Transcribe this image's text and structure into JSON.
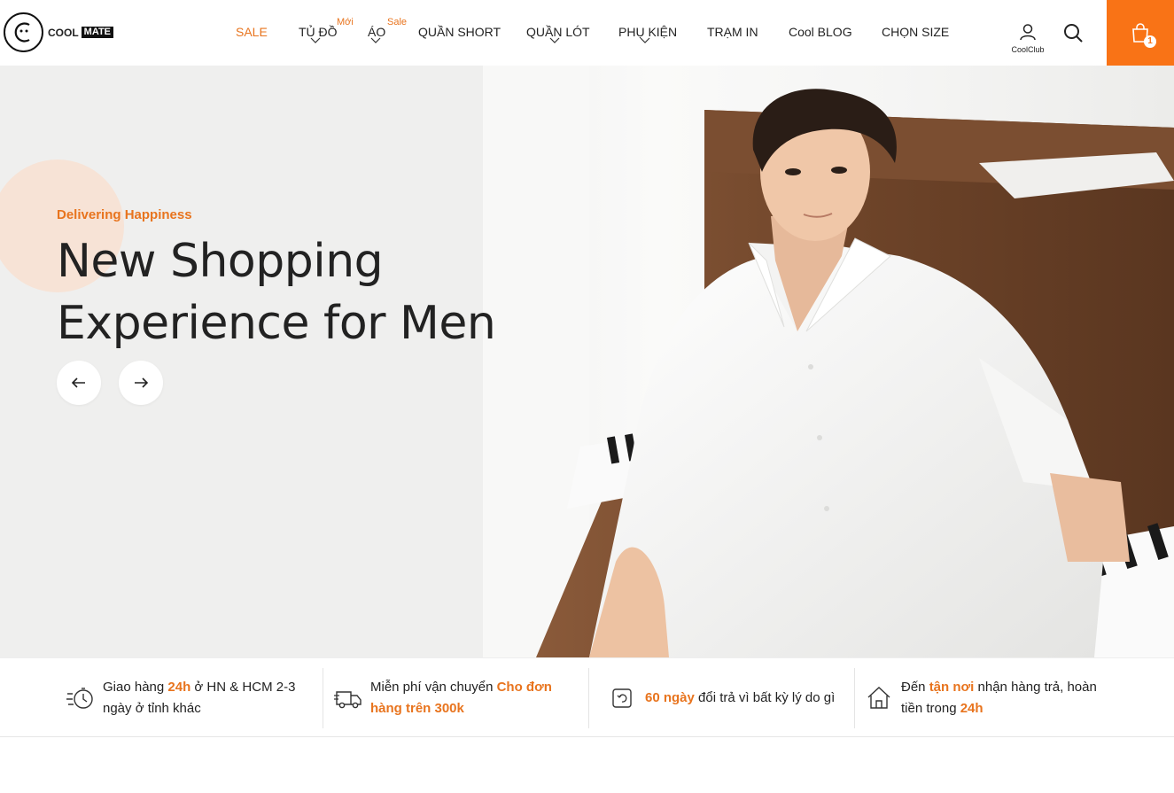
{
  "brand": {
    "logo_word1": "COOL",
    "logo_word2": "MATE",
    "accent": "#f97316"
  },
  "nav": {
    "items": [
      {
        "label": "SALE"
      },
      {
        "label": "TỦ ĐỒ",
        "badge": "Mới"
      },
      {
        "label": "ÁO",
        "badge": "Sale"
      },
      {
        "label": "QUẦN SHORT"
      },
      {
        "label": "QUẦN LÓT"
      },
      {
        "label": "PHỤ KIỆN"
      },
      {
        "label": "TRẠM IN"
      },
      {
        "label": "Cool BLOG"
      },
      {
        "label": "CHỌN SIZE"
      }
    ]
  },
  "header_actions": {
    "account_label": "CoolClub",
    "cart_count": "1"
  },
  "hero": {
    "eyebrow": "Delivering Happiness",
    "headline_line1": "New Shopping",
    "headline_line2": "Experience for Men",
    "prev_icon": "arrow-left-icon",
    "next_icon": "arrow-right-icon"
  },
  "features": [
    {
      "icon": "fast-delivery-icon",
      "t1": "Giao hàng ",
      "h1": "24h",
      "t2": " ở HN & HCM 2-3 ngày ở tỉnh khác",
      "h2": "",
      "t3": ""
    },
    {
      "icon": "truck-icon",
      "t1": "Miễn phí vận chuyển ",
      "h1": "Cho đơn hàng trên 300k",
      "t2": "",
      "h2": "",
      "t3": ""
    },
    {
      "icon": "return-icon",
      "t1": "",
      "h1": "60 ngày",
      "t2": " đổi trả vì bất kỳ lý do gì",
      "h2": "",
      "t3": ""
    },
    {
      "icon": "home-icon",
      "t1": "Đến ",
      "h1": "tận nơi",
      "t2": " nhận hàng trả, hoàn tiền trong ",
      "h2": "24h",
      "t3": ""
    }
  ]
}
